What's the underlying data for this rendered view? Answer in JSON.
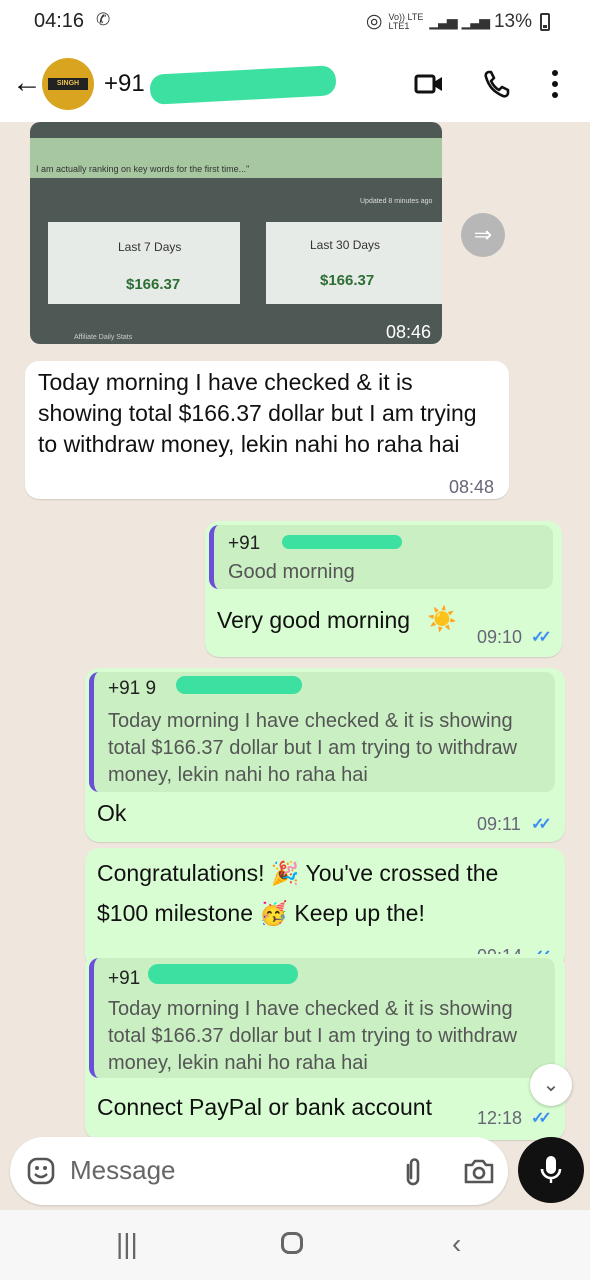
{
  "status": {
    "time": "04:16",
    "lte_top": "Vo)) LTE",
    "lte_bottom": "LTE1",
    "battery": "13%"
  },
  "header": {
    "contact_prefix": "+91",
    "avatar_text": "SINGH"
  },
  "chat": {
    "image_message": {
      "banner_text": "I am actually ranking on key words for the first time...\"",
      "updated_text": "Updated 8 minutes ago",
      "card1_label": "Last 7 Days",
      "card1_value": "$166.37",
      "card2_label": "Last 30 Days",
      "card2_value": "$166.37",
      "footer_text": "Affiliate Daily Stats",
      "time": "08:46"
    },
    "incoming_text": {
      "text": "Today morning I have checked & it is showing total $166.37 dollar but I am trying to withdraw money, lekin nahi ho raha hai",
      "time": "08:48"
    },
    "outgoing_1": {
      "quote_name": "+91",
      "quote_text": "Good morning",
      "text": "Very good morning",
      "emoji": "☀️",
      "time": "09:10"
    },
    "outgoing_2": {
      "quote_name": "+91 9",
      "quote_text": "Today morning I have checked & it is showing total $166.37 dollar but I am trying to withdraw money, lekin nahi ho raha hai",
      "text": "Ok",
      "time": "09:11"
    },
    "outgoing_3": {
      "text_part1": "Congratulations!",
      "emoji1": "🎉",
      "text_part2": "You've crossed the",
      "text_part3": "$100 milestone",
      "emoji2": "🥳",
      "text_part4": "Keep up the!",
      "time": "09:14"
    },
    "outgoing_4": {
      "quote_name": "+91",
      "quote_text": "Today morning I have checked & it is showing total $166.37 dollar but I am trying to withdraw money, lekin nahi ho raha hai",
      "text": "Connect PayPal or bank account",
      "time": "12:18"
    }
  },
  "input": {
    "placeholder": "Message"
  },
  "icons": {
    "back": "back-arrow-icon",
    "video": "video-call-icon",
    "call": "phone-icon",
    "menu": "more-vert-icon",
    "emoji": "emoji-icon",
    "attach": "attach-icon",
    "camera": "camera-icon",
    "mic": "mic-icon"
  }
}
